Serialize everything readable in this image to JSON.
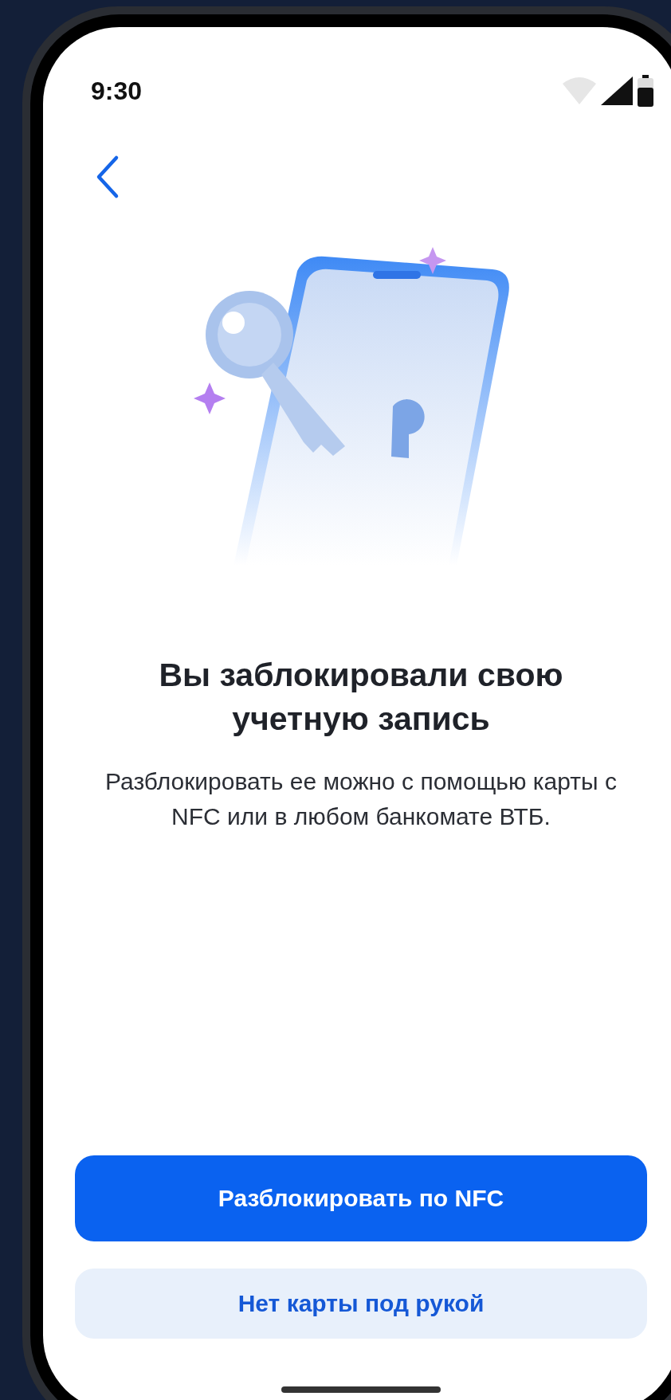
{
  "status_bar": {
    "time": "9:30"
  },
  "title": "Вы заблокировали свою учетную запись",
  "message": "Разблокировать ее можно с помощью карты с NFC или в любом банкомате ВТБ.",
  "buttons": [
    {
      "label": "Разблокировать по NFC",
      "kind": "primary"
    },
    {
      "label": "Нет карты под рукой",
      "kind": "secondary"
    }
  ]
}
